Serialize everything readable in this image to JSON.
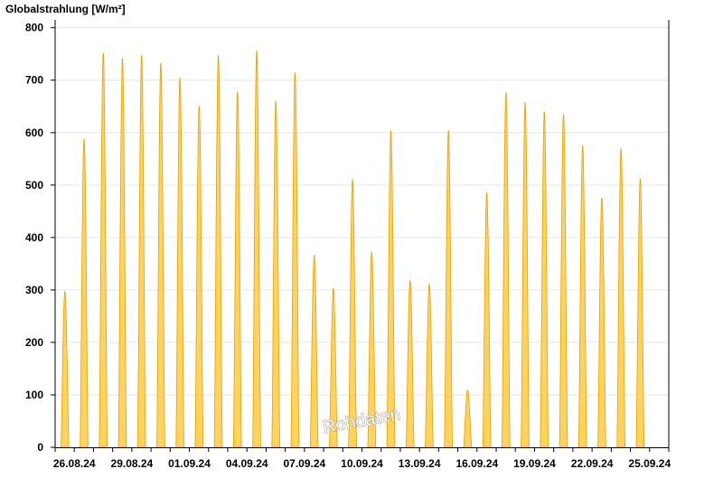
{
  "chart_data": {
    "type": "area",
    "title": "Globalstrahlung [W/m²]",
    "xlabel": "",
    "ylabel": "Globalstrahlung [W/m²]",
    "ylim": [
      0,
      815
    ],
    "yticks": [
      0,
      100,
      200,
      300,
      400,
      500,
      600,
      700,
      800
    ],
    "grid": true,
    "legend": "none",
    "watermark": "Rohdaten",
    "xlim_days": [
      "25.08.24",
      "26.09.24"
    ],
    "xtick_labels": [
      "26.08.24",
      "29.08.24",
      "01.09.24",
      "04.09.24",
      "07.09.24",
      "10.09.24",
      "13.09.24",
      "16.09.24",
      "19.09.24",
      "22.09.24",
      "25.09.24"
    ],
    "colors": {
      "fill": "#ffd35c",
      "stroke": "#ee9b00",
      "grid": "#e6e6e6",
      "axis": "#000000"
    },
    "series": [
      {
        "name": "",
        "daily_peaks": [
          {
            "date": "25.08.24",
            "peak": 297
          },
          {
            "date": "26.08.24",
            "peak": 588
          },
          {
            "date": "27.08.24",
            "peak": 752
          },
          {
            "date": "28.08.24",
            "peak": 742
          },
          {
            "date": "29.08.24",
            "peak": 748
          },
          {
            "date": "30.08.24",
            "peak": 733
          },
          {
            "date": "31.08.24",
            "peak": 705
          },
          {
            "date": "01.09.24",
            "peak": 651
          },
          {
            "date": "02.09.24",
            "peak": 748
          },
          {
            "date": "03.09.24",
            "peak": 678
          },
          {
            "date": "04.09.24",
            "peak": 757
          },
          {
            "date": "05.09.24",
            "peak": 661
          },
          {
            "date": "06.09.24",
            "peak": 714
          },
          {
            "date": "07.09.24",
            "peak": 366
          },
          {
            "date": "08.09.24",
            "peak": 303
          },
          {
            "date": "09.09.24",
            "peak": 511
          },
          {
            "date": "10.09.24",
            "peak": 372
          },
          {
            "date": "11.09.24",
            "peak": 604
          },
          {
            "date": "12.09.24",
            "peak": 318
          },
          {
            "date": "13.09.24",
            "peak": 311
          },
          {
            "date": "14.09.24",
            "peak": 605
          },
          {
            "date": "15.09.24",
            "peak": 109
          },
          {
            "date": "16.09.24",
            "peak": 486
          },
          {
            "date": "17.09.24",
            "peak": 677
          },
          {
            "date": "18.09.24",
            "peak": 658
          },
          {
            "date": "19.09.24",
            "peak": 640
          },
          {
            "date": "20.09.24",
            "peak": 636
          },
          {
            "date": "21.09.24",
            "peak": 575
          },
          {
            "date": "22.09.24",
            "peak": 476
          },
          {
            "date": "23.09.24",
            "peak": 570
          },
          {
            "date": "24.09.24",
            "peak": 512
          }
        ]
      }
    ]
  }
}
